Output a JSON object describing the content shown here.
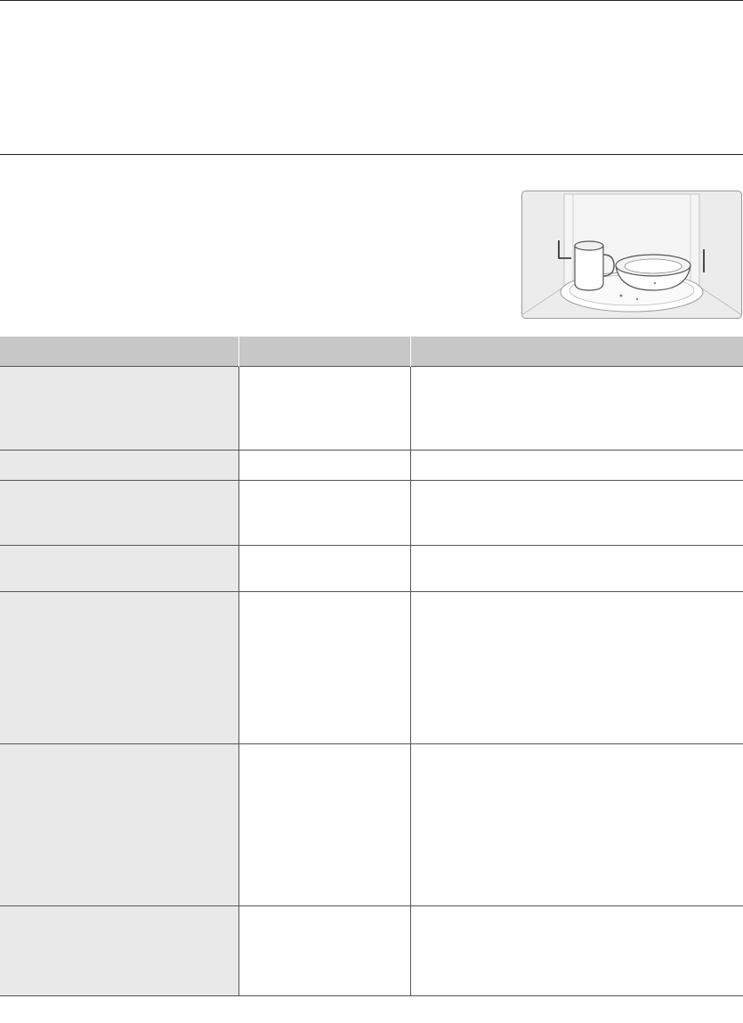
{
  "document": {
    "name": "microwave-reheating-guide-page"
  },
  "table": {
    "columns": [
      "",
      "",
      ""
    ],
    "rows": [
      [
        "",
        "",
        ""
      ],
      [
        "",
        "",
        ""
      ],
      [
        "",
        "",
        ""
      ],
      [
        "",
        "",
        ""
      ],
      [
        "",
        "",
        ""
      ],
      [
        "",
        "",
        ""
      ],
      [
        "",
        "",
        ""
      ]
    ]
  },
  "colors": {
    "header_fill": "#c7c7c7",
    "first_column_fill": "#e9e9e9",
    "rule_color": "#222222"
  },
  "icons": {
    "illustration": "microwave-cup-and-bowl-illustration"
  }
}
